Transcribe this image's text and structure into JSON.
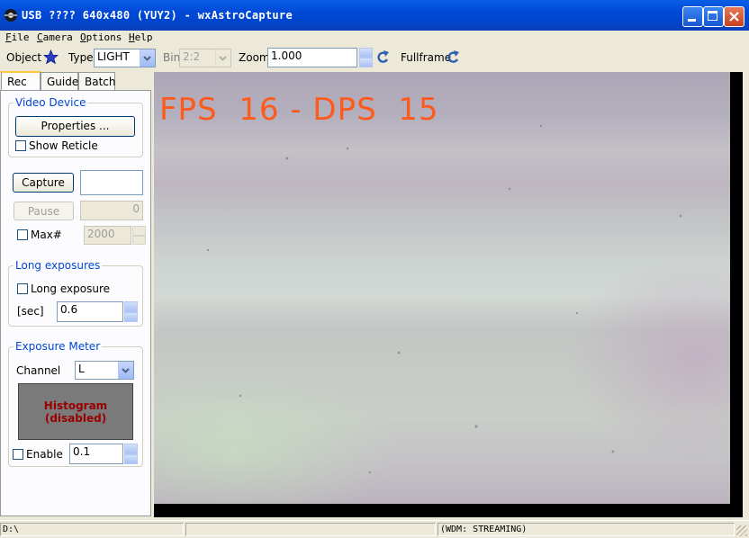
{
  "window": {
    "title": "USB ???? 640x480 (YUY2) - wxAstroCapture",
    "controls": [
      "minimize",
      "maximize",
      "close"
    ]
  },
  "menu": [
    "File",
    "Camera",
    "Options",
    "Help"
  ],
  "toolbar": {
    "object_label": "Object",
    "type_label": "Type",
    "type_value": "LIGHT",
    "bin_label": "Bin",
    "bin_value": "2:2",
    "zoom_label": "Zoom",
    "zoom_value": "1.000",
    "fullframe_label": "Fullframe"
  },
  "tabs": [
    "Rec",
    "Guide",
    "Batch"
  ],
  "active_tab": "Rec",
  "video_device": {
    "title": "Video Device",
    "properties_button": "Properties ...",
    "show_reticle": "Show Reticle",
    "show_reticle_checked": false
  },
  "capture": {
    "capture_button": "Capture",
    "capture_field": "",
    "pause_button": "Pause",
    "pause_field": "0",
    "max_label": "Max#",
    "max_checked": false,
    "max_value": "2000"
  },
  "long_exposures": {
    "title": "Long exposures",
    "long_exposure_label": "Long exposure",
    "long_exposure_checked": false,
    "sec_label": "[sec]",
    "sec_value": "0.6"
  },
  "exposure_meter": {
    "title": "Exposure Meter",
    "channel_label": "Channel",
    "channel_value": "L",
    "histogram_line1": "Histogram",
    "histogram_line2": "(disabled)",
    "enable_label": "Enable",
    "enable_checked": false,
    "enable_value": "0.1"
  },
  "overlay": {
    "fps_text": "FPS  16 - DPS  15"
  },
  "status": {
    "left": "D:\\",
    "middle": "",
    "right": "(WDM: STREAMING)"
  },
  "colors": {
    "title_bar": "#0054e3",
    "overlay_text": "#ff5a1e",
    "group_title": "#0046d5",
    "histogram_text": "#9a0000"
  }
}
